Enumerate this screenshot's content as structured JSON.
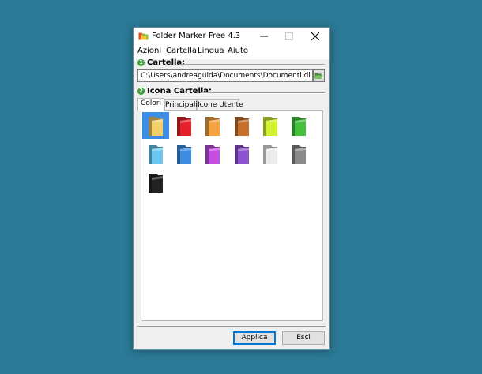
{
  "window": {
    "title": "Folder Marker Free 4.3",
    "icons": {
      "app": "folder-marker-app-icon",
      "minimize": "minimize-icon",
      "maximize": "maximize-icon",
      "close": "close-icon"
    }
  },
  "menu": [
    "Azioni",
    "Cartella",
    "Lingua",
    "Aiuto"
  ],
  "folder_section": {
    "number": "1",
    "label": "Cartella:",
    "path": "C:\\Users\\andreaguida\\Documents\\Documenti di lavoro",
    "browse_icon": "open-folder-icon"
  },
  "icon_section": {
    "number": "2",
    "label": "Icona Cartella:",
    "tabs": [
      "Colori",
      "Principali",
      "Icone Utente"
    ],
    "active_tab": "Colori",
    "folders": [
      {
        "name": "yellow",
        "color": "#f5cd6a",
        "selected": true
      },
      {
        "name": "red",
        "color": "#e5212b"
      },
      {
        "name": "orange",
        "color": "#f4a340"
      },
      {
        "name": "brown",
        "color": "#c7702c"
      },
      {
        "name": "lime",
        "color": "#d4f22e"
      },
      {
        "name": "green",
        "color": "#44c03c"
      },
      {
        "name": "light-blue",
        "color": "#6cc6ef"
      },
      {
        "name": "blue",
        "color": "#3d8de3"
      },
      {
        "name": "magenta",
        "color": "#c34fe0"
      },
      {
        "name": "purple",
        "color": "#8f52cf"
      },
      {
        "name": "white",
        "color": "#ececec"
      },
      {
        "name": "gray",
        "color": "#8a8a8a"
      },
      {
        "name": "black",
        "color": "#222222"
      }
    ]
  },
  "buttons": {
    "apply": "Applica",
    "exit": "Esci"
  },
  "colors": {
    "desktop": "#2b7a96",
    "accent": "#0078d7",
    "selection": "#3b8ee3",
    "step_badge": "#3aa236"
  }
}
